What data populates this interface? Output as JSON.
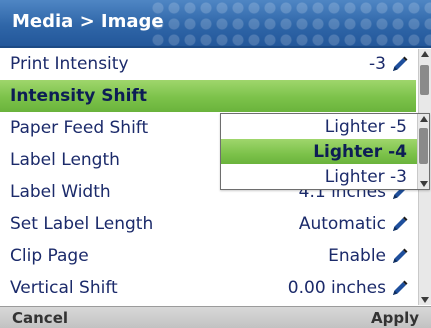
{
  "header": {
    "title": "Media > Image"
  },
  "rows": [
    {
      "label": "Print Intensity",
      "value": "-3",
      "has_edit": true
    },
    {
      "label": "Intensity Shift",
      "value": "",
      "has_edit": false,
      "selected": true
    },
    {
      "label": "Paper Feed Shift",
      "value": "",
      "has_edit": false
    },
    {
      "label": "Label Length",
      "value": "",
      "has_edit": false
    },
    {
      "label": "Label Width",
      "value": "4.1 inches",
      "has_edit": true
    },
    {
      "label": "Set Label Length",
      "value": "Automatic",
      "has_edit": true
    },
    {
      "label": "Clip Page",
      "value": "Enable",
      "has_edit": true
    },
    {
      "label": "Vertical Shift",
      "value": "0.00 inches",
      "has_edit": true
    }
  ],
  "dropdown": {
    "options": [
      "Lighter -5",
      "Lighter -4",
      "Lighter -3"
    ],
    "selected": "Lighter -4"
  },
  "footer": {
    "left": "Cancel",
    "right": "Apply"
  },
  "colors": {
    "header": "#2f66a8",
    "selection": "#7cc24a",
    "text": "#1b2a6a"
  },
  "icons": {
    "edit": "pencil-icon"
  }
}
